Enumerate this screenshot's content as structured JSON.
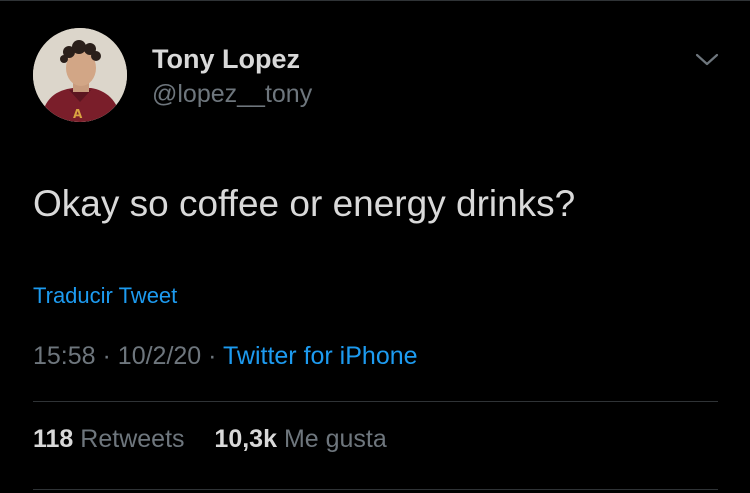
{
  "author": {
    "display_name": "Tony Lopez",
    "handle": "@lopez__tony"
  },
  "tweet": {
    "text": "Okay so coffee or energy drinks?",
    "translate_label": "Traducir Tweet",
    "time": "15:58",
    "separator": "·",
    "date": "10/2/20",
    "source": "Twitter for iPhone"
  },
  "stats": {
    "retweets_count": "118",
    "retweets_label": "Retweets",
    "likes_count": "10,3k",
    "likes_label": "Me gusta"
  },
  "icons": {
    "menu": "chevron-down-icon",
    "avatar": "avatar"
  },
  "colors": {
    "background": "#000000",
    "text_primary": "#d9d9d9",
    "text_secondary": "#6e767d",
    "link": "#1d9bf0",
    "divider": "#2f3336"
  }
}
